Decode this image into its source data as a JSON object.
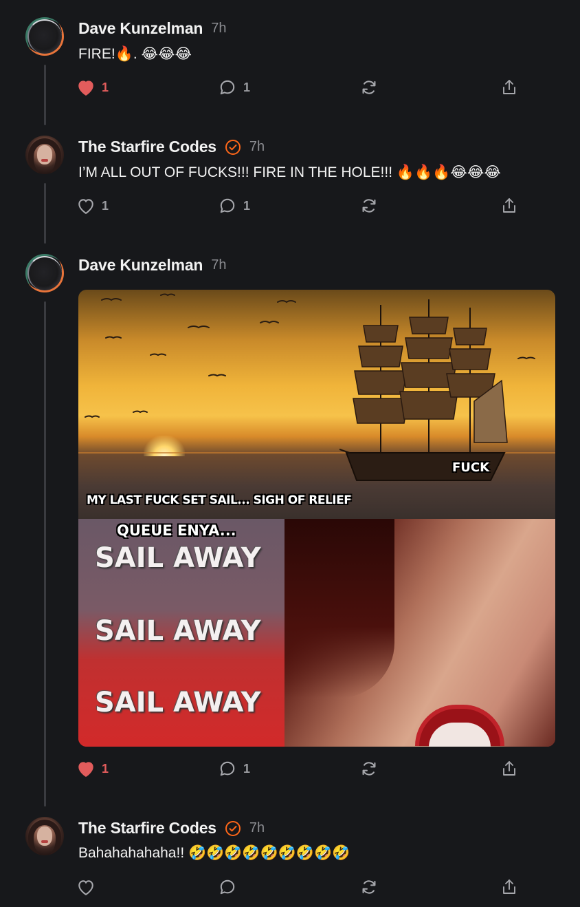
{
  "posts": [
    {
      "author": "Dave Kunzelman",
      "time": "7h",
      "verified": false,
      "avatar_icon": "dave-avatar",
      "text": "FIRE!🔥. 😂😂😂",
      "likes": "1",
      "liked": true,
      "comments": "1"
    },
    {
      "author": "The Starfire Codes",
      "time": "7h",
      "verified": true,
      "avatar_icon": "starfire-avatar",
      "text": "I’M ALL OUT OF FUCKS!!! FIRE IN THE HOLE!!! 🔥🔥🔥😂😂😂",
      "likes": "1",
      "liked": false,
      "comments": "1"
    },
    {
      "author": "Dave Kunzelman",
      "time": "7h",
      "verified": false,
      "avatar_icon": "dave-avatar",
      "text": "",
      "likes": "1",
      "liked": true,
      "comments": "1",
      "meme": {
        "top_caption": "MY LAST FUCK SET SAIL...  SIGH OF RELIEF",
        "ship_tag": "FUCK",
        "queue_text": "QUEUE ENYA...",
        "sail_lines": [
          "SAIL AWAY",
          "SAIL AWAY",
          "SAIL AWAY"
        ]
      }
    },
    {
      "author": "The Starfire Codes",
      "time": "7h",
      "verified": true,
      "avatar_icon": "starfire-avatar",
      "text": "Bahahahahaha!! 🤣🤣🤣🤣🤣🤣🤣🤣🤣",
      "likes": "",
      "liked": false,
      "comments": ""
    }
  ],
  "colors": {
    "background": "#17181b",
    "like_active": "#e25c5c",
    "verified": "#ff6719",
    "muted": "#8c8d92"
  },
  "icons": [
    "heart-icon",
    "comment-icon",
    "restack-icon",
    "share-icon",
    "verified-badge-icon"
  ]
}
